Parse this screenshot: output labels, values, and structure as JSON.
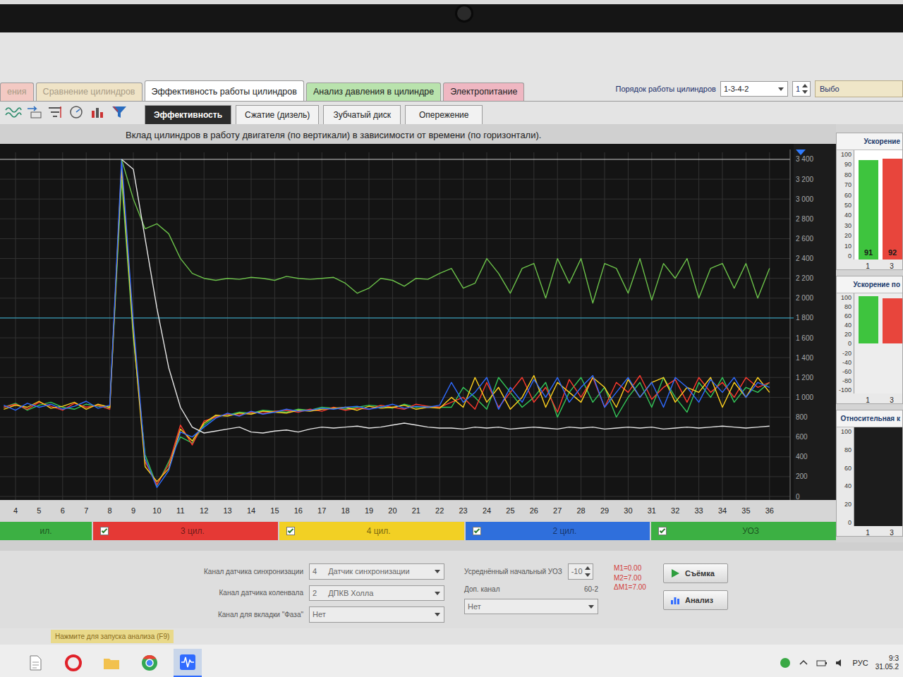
{
  "tabs": [
    {
      "label": "ения",
      "selected": false,
      "color": "#f3c9c3"
    },
    {
      "label": "Сравнение цилиндров",
      "selected": false,
      "color": "#efe3c6"
    },
    {
      "label": "Эффективность работы цилиндров",
      "selected": true,
      "color": "#ffffff"
    },
    {
      "label": "Анализ давления в цилиндре",
      "selected": false,
      "color": "#b9e3ad"
    },
    {
      "label": "Электропитание",
      "selected": false,
      "color": "#efb7c2"
    }
  ],
  "cylinder_order": {
    "label": "Порядок работы цилиндров",
    "value": "1-3-4-2",
    "spinner": "1",
    "chooser": "Выбо"
  },
  "subtabs": [
    {
      "label": "Эффективность",
      "selected": true
    },
    {
      "label": "Сжатие (дизель)",
      "selected": false
    },
    {
      "label": "Зубчатый диск",
      "selected": false
    },
    {
      "label": "Опережение",
      "selected": false
    }
  ],
  "chart": {
    "title": "Вклад цилиндров в работу двигателя (по вертикали) в зависимости от времени (по горизонтали).",
    "x_from": 3.5,
    "x_step": 0.5,
    "reference_line": 1800,
    "y_ticks": [
      {
        "value": 3400,
        "label": "3 400"
      },
      {
        "value": 3200,
        "label": "3 200"
      },
      {
        "value": 3000,
        "label": "3 000"
      },
      {
        "value": 2800,
        "label": "2 800"
      },
      {
        "value": 2600,
        "label": "2 600"
      },
      {
        "value": 2400,
        "label": "2 400"
      },
      {
        "value": 2200,
        "label": "2 200"
      },
      {
        "value": 2000,
        "label": "2 000"
      },
      {
        "value": 1800,
        "label": "1 800"
      },
      {
        "value": 1600,
        "label": "1 600"
      },
      {
        "value": 1400,
        "label": "1 400"
      },
      {
        "value": 1200,
        "label": "1 200"
      },
      {
        "value": 1000,
        "label": "1 000"
      },
      {
        "value": 800,
        "label": "800"
      },
      {
        "value": 600,
        "label": "600"
      },
      {
        "value": 400,
        "label": "400"
      },
      {
        "value": 200,
        "label": "200"
      },
      {
        "value": 0,
        "label": "0"
      }
    ],
    "x_ticks": [
      {
        "value": 4,
        "label": "4"
      },
      {
        "value": 5,
        "label": "5"
      },
      {
        "value": 6,
        "label": "6"
      },
      {
        "value": 7,
        "label": "7"
      },
      {
        "value": 8,
        "label": "8"
      },
      {
        "value": 9,
        "label": "9"
      },
      {
        "value": 10,
        "label": "10"
      },
      {
        "value": 11,
        "label": "11"
      },
      {
        "value": 12,
        "label": "12"
      },
      {
        "value": 13,
        "label": "13"
      },
      {
        "value": 14,
        "label": "14"
      },
      {
        "value": 15,
        "label": "15"
      },
      {
        "value": 16,
        "label": "16"
      },
      {
        "value": 17,
        "label": "17"
      },
      {
        "value": 18,
        "label": "18"
      },
      {
        "value": 19,
        "label": "19"
      },
      {
        "value": 20,
        "label": "20"
      },
      {
        "value": 21,
        "label": "21"
      },
      {
        "value": 22,
        "label": "22"
      },
      {
        "value": 23,
        "label": "23"
      },
      {
        "value": 24,
        "label": "24"
      },
      {
        "value": 25,
        "label": "25"
      },
      {
        "value": 26,
        "label": "26"
      },
      {
        "value": 27,
        "label": "27"
      },
      {
        "value": 28,
        "label": "28"
      },
      {
        "value": 29,
        "label": "29"
      },
      {
        "value": 30,
        "label": "30"
      },
      {
        "value": 31,
        "label": "31"
      },
      {
        "value": 32,
        "label": "32"
      },
      {
        "value": 33,
        "label": "33"
      },
      {
        "value": 34,
        "label": "34"
      },
      {
        "value": 35,
        "label": "35"
      },
      {
        "value": 36,
        "label": "36"
      }
    ],
    "series": [
      {
        "color": "#34c759",
        "values": [
          900,
          940,
          870,
          920,
          950,
          900,
          880,
          930,
          910,
          890,
          3200,
          1600,
          420,
          110,
          350,
          600,
          540,
          720,
          810,
          820,
          850,
          840,
          870,
          860,
          850,
          880,
          870,
          900,
          890,
          880,
          900,
          920,
          910,
          890,
          930,
          900,
          910,
          900,
          900,
          1100,
          1000,
          880,
          1200,
          1050,
          900,
          1000,
          1150,
          800,
          1050,
          1200,
          950,
          1100,
          800,
          1000,
          1150,
          900,
          1200,
          1000,
          850,
          1150,
          1000,
          1200,
          950,
          1100,
          1050,
          1150
        ]
      },
      {
        "color": "#ff3a2f",
        "values": [
          900,
          930,
          880,
          950,
          910,
          870,
          940,
          900,
          920,
          880,
          3350,
          1700,
          350,
          120,
          320,
          720,
          520,
          760,
          800,
          830,
          820,
          850,
          840,
          860,
          870,
          850,
          880,
          860,
          900,
          870,
          890,
          880,
          920,
          900,
          880,
          930,
          910,
          900,
          950,
          1000,
          880,
          1150,
          900,
          1050,
          1200,
          950,
          1100,
          850,
          1180,
          1000,
          1200,
          900,
          1150,
          1050,
          1220,
          980,
          1100,
          1180,
          950,
          1200,
          1050,
          1150,
          1000,
          1200,
          1100,
          1150
        ]
      },
      {
        "color": "#ffd21f",
        "values": [
          880,
          920,
          900,
          960,
          890,
          910,
          950,
          880,
          930,
          900,
          3300,
          1650,
          300,
          150,
          280,
          680,
          560,
          740,
          820,
          810,
          840,
          830,
          860,
          850,
          840,
          870,
          860,
          880,
          890,
          900,
          870,
          910,
          890,
          900,
          920,
          880,
          900,
          890,
          1000,
          900,
          1200,
          950,
          1100,
          880,
          1000,
          1220,
          900,
          1150,
          1050,
          950,
          1200,
          1100,
          900,
          1180,
          1000,
          1150,
          1200,
          950,
          1100,
          1050,
          1200,
          900,
          1150,
          1000,
          1200,
          1050
        ]
      },
      {
        "color": "#2f6bff",
        "values": [
          920,
          870,
          940,
          900,
          930,
          880,
          910,
          960,
          890,
          920,
          3400,
          1750,
          380,
          90,
          260,
          650,
          600,
          700,
          790,
          840,
          810,
          860,
          830,
          850,
          880,
          860,
          870,
          890,
          880,
          900,
          910,
          880,
          900,
          930,
          890,
          910,
          900,
          920,
          1150,
          950,
          1050,
          1200,
          880,
          1100,
          950,
          1180,
          1000,
          1200,
          950,
          1100,
          1220,
          900,
          1050,
          1200,
          1000,
          1150,
          900,
          1200,
          1100,
          950,
          1180,
          1050,
          1200,
          1000,
          1150,
          1100
        ]
      },
      {
        "color": "#6cc24a",
        "values": [
          null,
          null,
          null,
          null,
          null,
          null,
          null,
          null,
          null,
          null,
          3400,
          3000,
          2700,
          2750,
          2650,
          2400,
          2250,
          2200,
          2180,
          2200,
          2190,
          2210,
          2200,
          2180,
          2220,
          2200,
          2190,
          2200,
          2210,
          2150,
          2050,
          2100,
          2200,
          2180,
          2120,
          2200,
          2190,
          2250,
          2300,
          2100,
          2150,
          2400,
          2250,
          2050,
          2300,
          2350,
          2000,
          2400,
          2150,
          2400,
          1950,
          2350,
          2300,
          2050,
          2400,
          1980,
          2350,
          2200,
          2400,
          2000,
          2300,
          2350,
          2100,
          2350,
          2000,
          2300
        ]
      },
      {
        "color": "#e6e6e6",
        "values": [
          null,
          null,
          null,
          null,
          null,
          null,
          null,
          null,
          null,
          null,
          3400,
          3300,
          2600,
          1900,
          1300,
          900,
          700,
          640,
          660,
          680,
          700,
          650,
          640,
          660,
          670,
          650,
          680,
          700,
          690,
          700,
          710,
          690,
          700,
          720,
          740,
          720,
          700,
          690,
          690,
          680,
          700,
          690,
          700,
          680,
          690,
          700,
          690,
          680,
          700,
          690,
          700,
          680,
          690,
          700,
          690,
          700,
          680,
          690,
          700,
          690,
          700,
          710,
          700,
          690,
          700,
          710
        ]
      }
    ]
  },
  "legend": [
    {
      "label": "ил.",
      "color": "#3cb043"
    },
    {
      "label": "3 цил.",
      "checked": true,
      "color": "#e53935"
    },
    {
      "label": "4 цил.",
      "checked": true,
      "color": "#f2d024"
    },
    {
      "label": "2 цил.",
      "checked": true,
      "color": "#2f6fdc"
    },
    {
      "label": "УОЗ",
      "checked": true,
      "color": "#3cb043"
    }
  ],
  "side_panels": [
    {
      "title": "Ускорение",
      "ticks": [
        {
          "value": 100,
          "label": "100"
        },
        {
          "value": 90,
          "label": "90"
        },
        {
          "value": 80,
          "label": "80"
        },
        {
          "value": 70,
          "label": "70"
        },
        {
          "value": 60,
          "label": "60"
        },
        {
          "value": 50,
          "label": "50"
        },
        {
          "value": 40,
          "label": "40"
        },
        {
          "value": 30,
          "label": "30"
        },
        {
          "value": 20,
          "label": "20"
        },
        {
          "value": 10,
          "label": "10"
        },
        {
          "value": 0,
          "label": "0"
        }
      ],
      "bars": [
        {
          "label": "1",
          "value": 91,
          "reading": "91",
          "color": "#3ec43e"
        },
        {
          "label": "3",
          "value": 92,
          "reading": "92",
          "color": "#e8453c"
        }
      ]
    },
    {
      "title": "Ускорение по",
      "ticks": [
        {
          "value": 100,
          "label": "100"
        },
        {
          "value": 80,
          "label": "80"
        },
        {
          "value": 60,
          "label": "60"
        },
        {
          "value": 40,
          "label": "40"
        },
        {
          "value": 20,
          "label": "20"
        },
        {
          "value": 0,
          "label": "0"
        },
        {
          "value": -20,
          "label": "-20"
        },
        {
          "value": -40,
          "label": "-40"
        },
        {
          "value": -60,
          "label": "-60"
        },
        {
          "value": -80,
          "label": "-80"
        },
        {
          "value": -100,
          "label": "-100"
        }
      ],
      "bars": [
        {
          "label": "1",
          "value": 95,
          "color": "#3ec43e"
        },
        {
          "label": "3",
          "value": 90,
          "color": "#e8453c"
        }
      ]
    },
    {
      "title": "Относительная к",
      "ticks": [
        {
          "value": 100,
          "label": "100"
        },
        {
          "value": 80,
          "label": "80"
        },
        {
          "value": 60,
          "label": "60"
        },
        {
          "value": 40,
          "label": "40"
        },
        {
          "value": 20,
          "label": "20"
        },
        {
          "value": 0,
          "label": "0"
        }
      ],
      "bars": [
        {
          "label": "1",
          "value": 0,
          "color": "#3ec43e"
        },
        {
          "label": "3",
          "value": 0,
          "color": "#e8453c"
        }
      ]
    }
  ],
  "settings": {
    "channels": [
      {
        "label": "Канал датчика синхронизации",
        "number": "4",
        "value": "Датчик синхронизации"
      },
      {
        "label": "Канал датчика коленвала",
        "number": "2",
        "value": "ДПКВ Холла"
      },
      {
        "label": "Канал для вкладки \"Фаза\"",
        "number": "",
        "value": "Нет"
      }
    ],
    "uoz_label": "Усреднённый начальный УОЗ",
    "uoz_value": "-10",
    "extra_label": "Доп. канал",
    "teeth": "60-2",
    "extra_value": "Нет",
    "markers": [
      "M1=0.00",
      "M2=7.00",
      "ΔM1=7.00"
    ]
  },
  "buttons": [
    {
      "label": "Съёмка",
      "kind": "record"
    },
    {
      "label": "Анализ",
      "kind": "analyze"
    }
  ],
  "status": "Нажмите для запуска анализа (F9)",
  "taskbar": {
    "apps": [
      {
        "kind": "doc",
        "selected": false
      },
      {
        "kind": "opera",
        "selected": false
      },
      {
        "kind": "folder",
        "selected": false
      },
      {
        "kind": "chrome",
        "selected": false
      },
      {
        "kind": "scope",
        "selected": true
      }
    ],
    "language": "РУС",
    "time": "9:3",
    "date": "31.05.2"
  }
}
